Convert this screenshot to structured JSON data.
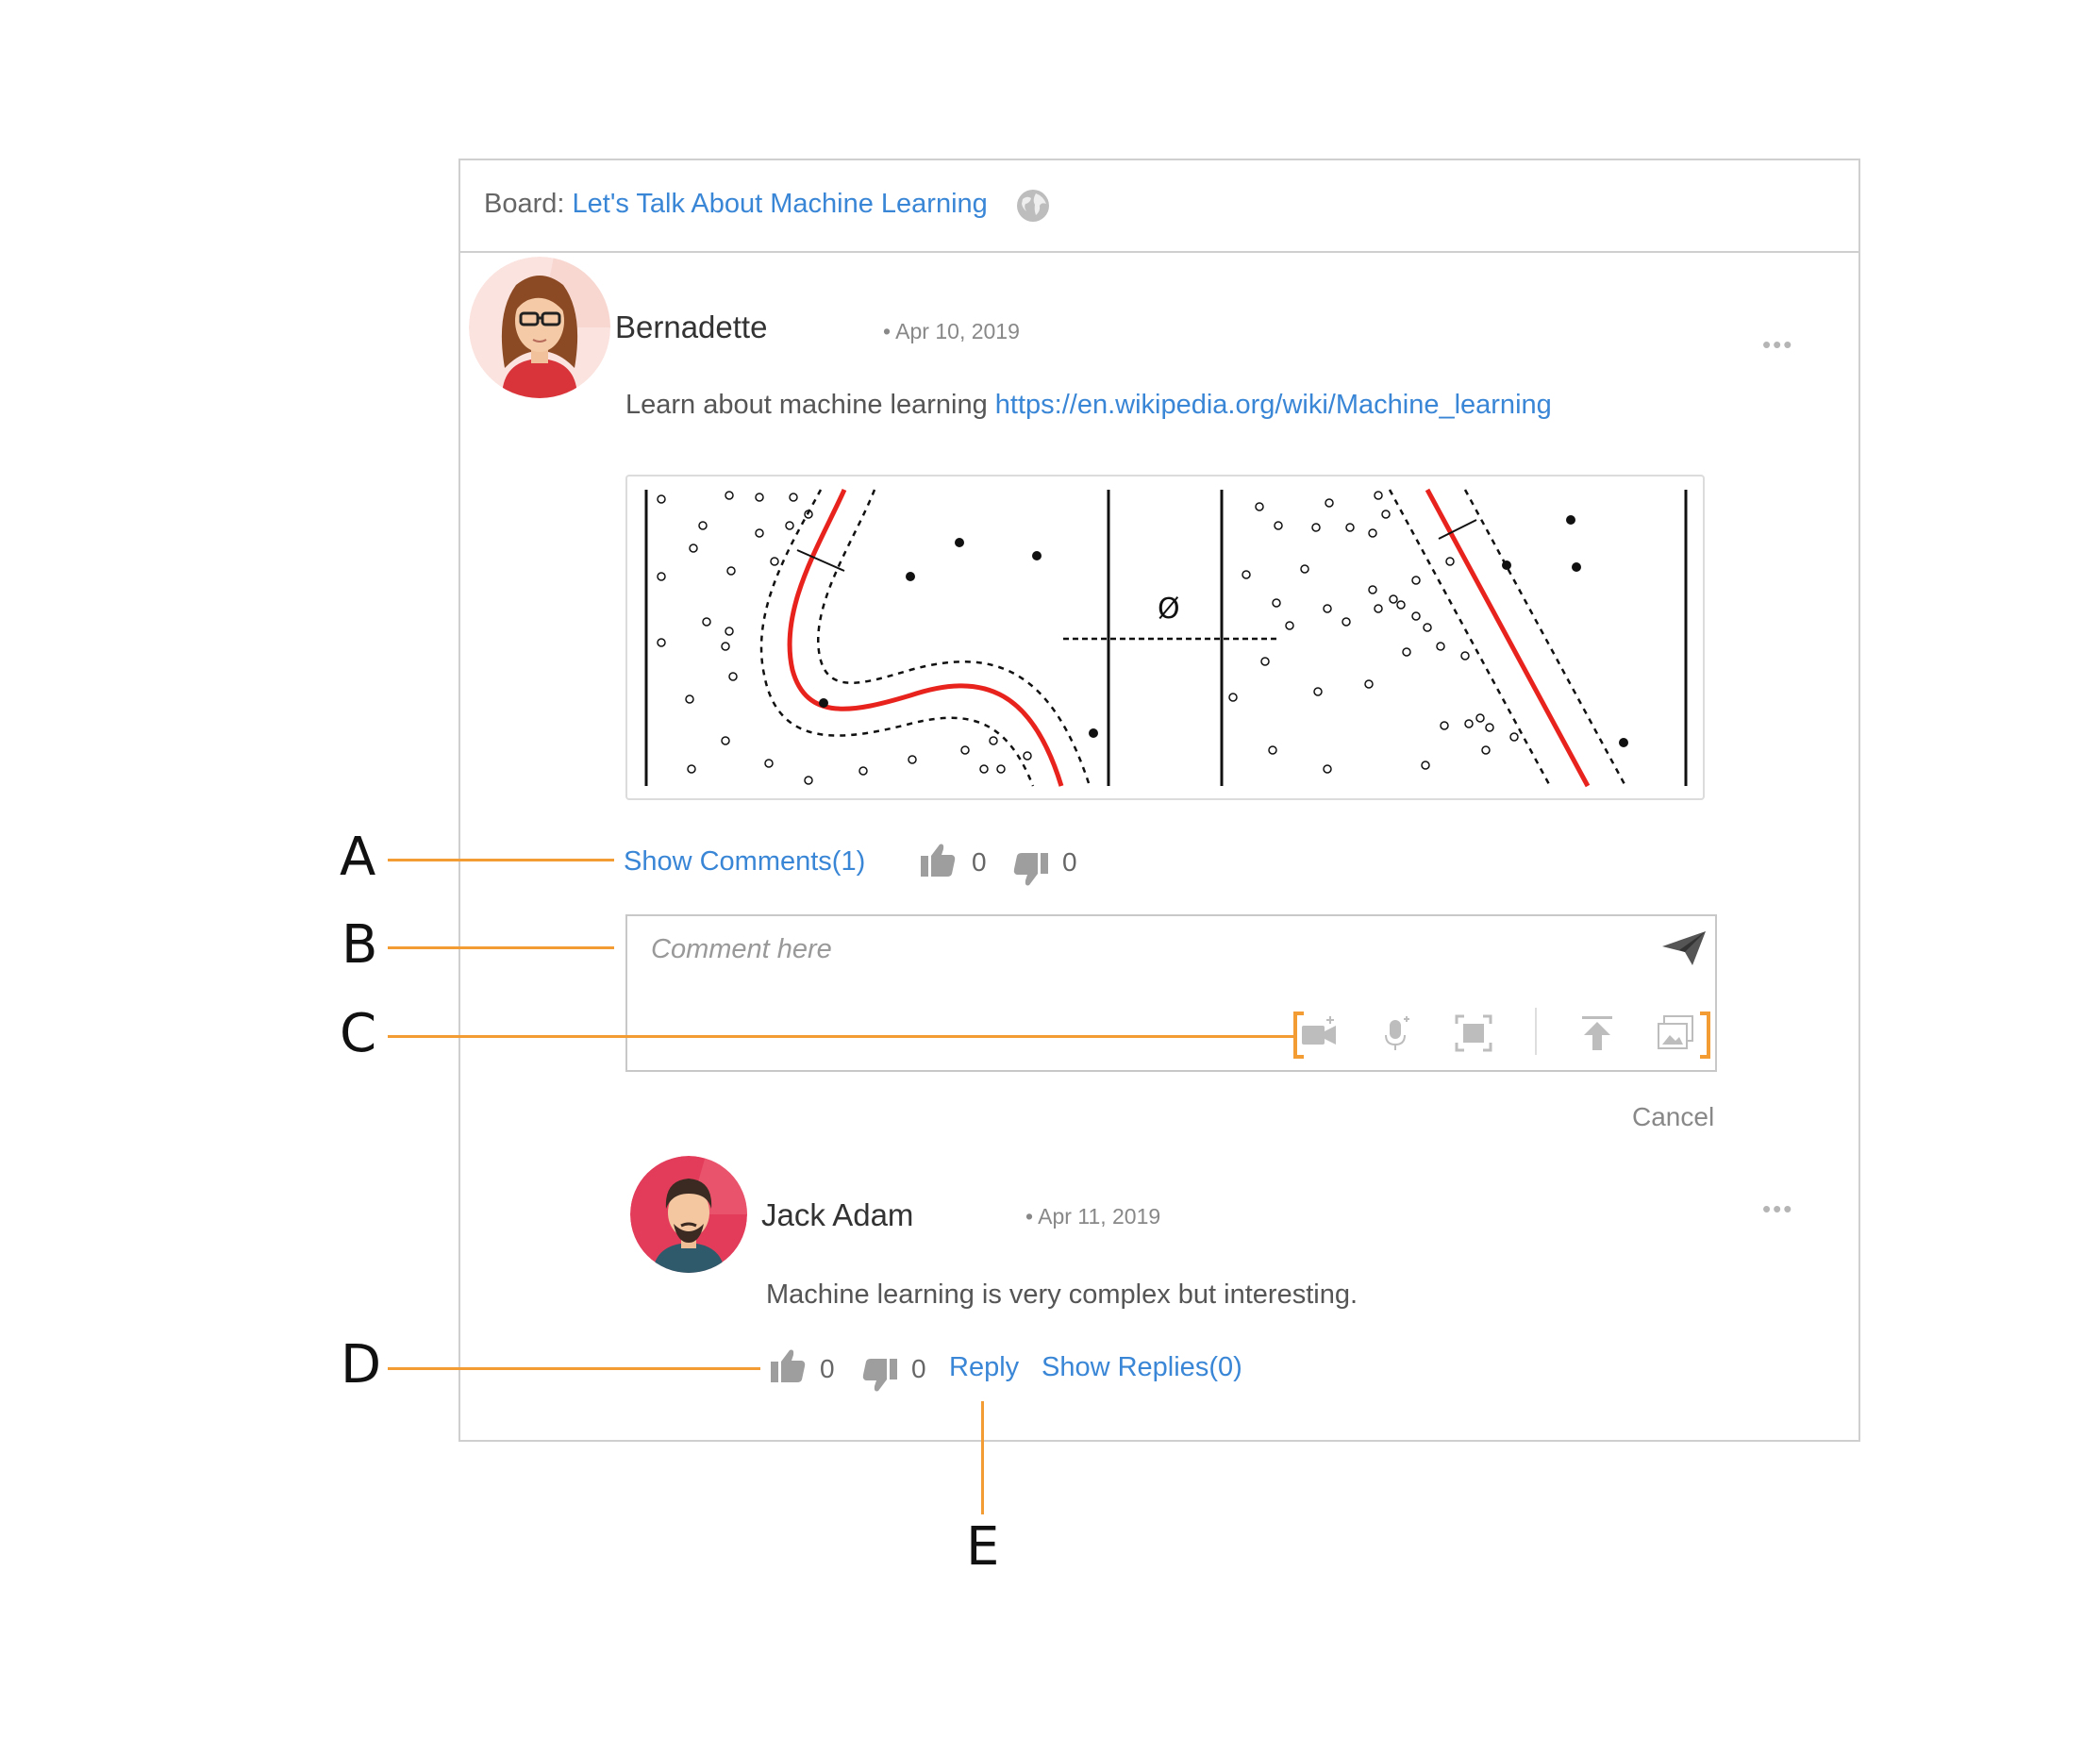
{
  "board": {
    "prefix": "Board: ",
    "title": "Let's Talk About Machine Learning"
  },
  "post": {
    "author": "Bernadette",
    "date": "• Apr 10, 2019",
    "text": "Learn about machine learning ",
    "url": "https://en.wikipedia.org/wiki/Machine_learning",
    "figure_symbol": "Ø",
    "more": "•••",
    "show_comments": "Show Comments(1)",
    "likes": "0",
    "dislikes": "0"
  },
  "comment_input": {
    "placeholder": "Comment here",
    "cancel": "Cancel"
  },
  "reply": {
    "author": "Jack Adam",
    "date": "• Apr 11, 2019",
    "text": "Machine learning is very complex but interesting.",
    "more": "•••",
    "likes": "0",
    "dislikes": "0",
    "reply_label": "Reply",
    "show_replies": "Show Replies(0)"
  },
  "callouts": {
    "a": "A",
    "b": "B",
    "c": "C",
    "d": "D",
    "e": "E"
  },
  "colors": {
    "link": "#3a86d6",
    "callout_line": "#f39c34",
    "border": "#cfcfcf",
    "curve": "#e8231e"
  }
}
